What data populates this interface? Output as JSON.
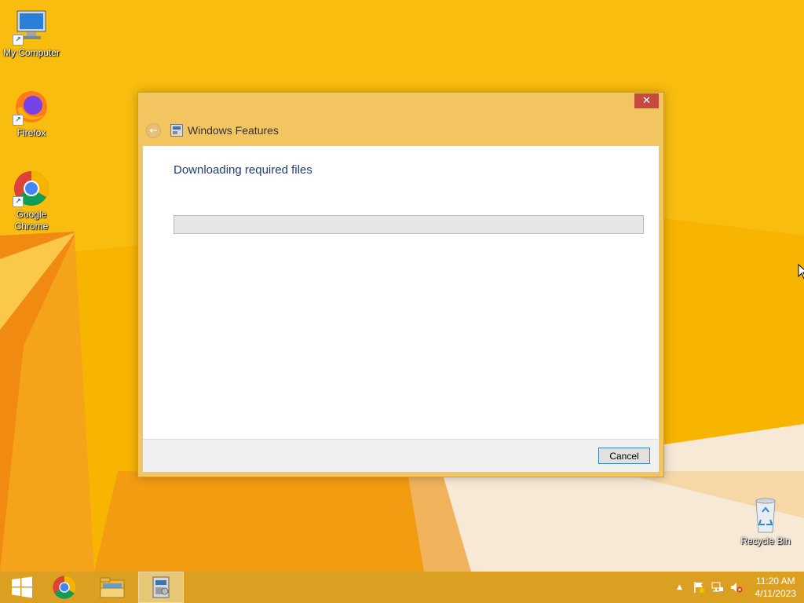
{
  "desktop": {
    "icons": [
      {
        "label": "My Computer",
        "icon": "computer-icon"
      },
      {
        "label": "Firefox",
        "icon": "firefox-icon"
      },
      {
        "label": "Google\nChrome",
        "icon": "chrome-icon"
      },
      {
        "label": "Recycle Bin",
        "icon": "recycle-bin-icon"
      }
    ]
  },
  "dialog": {
    "close_label": "✕",
    "back_label": "←",
    "title": "Windows Features",
    "heading": "Downloading required files",
    "progress": 0,
    "cancel_label": "Cancel"
  },
  "taskbar": {
    "items": [
      {
        "icon": "windows-start-icon"
      },
      {
        "icon": "chrome-icon"
      },
      {
        "icon": "file-explorer-icon"
      },
      {
        "icon": "windows-features-icon",
        "active": true
      }
    ],
    "tray": {
      "overflow_label": "▲",
      "time": "11:20 AM",
      "date": "4/11/2023"
    }
  },
  "colors": {
    "wallpaper": "#f6b300",
    "dialog_frame": "#f2c560",
    "close_button": "#c74a3f",
    "taskbar": "#dba021",
    "heading_text": "#1f3b73"
  }
}
